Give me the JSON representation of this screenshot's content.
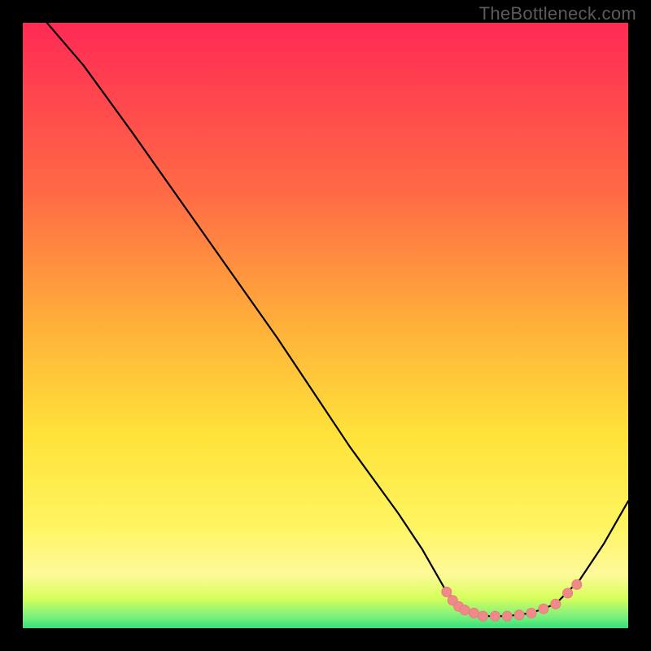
{
  "watermark": "TheBottleneck.com",
  "colors": {
    "frame": "#000000",
    "watermark": "#5b5b5b",
    "gradient_top": "#ff2a55",
    "gradient_mid_orange": "#ff8a3c",
    "gradient_yellow": "#ffe23a",
    "gradient_pale_yellow": "#fff99a",
    "gradient_lime": "#d7ff5b",
    "gradient_green": "#35e27a",
    "curve": "#000000",
    "marker_fill": "#f08a8a",
    "marker_stroke": "#e77d7d"
  },
  "chart_data": {
    "type": "line",
    "title": "",
    "xlabel": "",
    "ylabel": "",
    "x_range": [
      0,
      100
    ],
    "y_range": [
      0,
      100
    ],
    "curve": {
      "name": "bottleneck-curve",
      "points": [
        {
          "x": 4,
          "y": 100
        },
        {
          "x": 10,
          "y": 93
        },
        {
          "x": 18,
          "y": 82
        },
        {
          "x": 30,
          "y": 65
        },
        {
          "x": 42,
          "y": 48
        },
        {
          "x": 54,
          "y": 30
        },
        {
          "x": 62,
          "y": 19
        },
        {
          "x": 66,
          "y": 13
        },
        {
          "x": 70,
          "y": 6
        },
        {
          "x": 73,
          "y": 3
        },
        {
          "x": 76,
          "y": 2
        },
        {
          "x": 80,
          "y": 2
        },
        {
          "x": 84,
          "y": 2.5
        },
        {
          "x": 88,
          "y": 4
        },
        {
          "x": 92,
          "y": 8
        },
        {
          "x": 96,
          "y": 14
        },
        {
          "x": 100,
          "y": 21
        }
      ]
    },
    "markers": {
      "name": "highlighted-range",
      "points": [
        {
          "x": 70,
          "y": 6
        },
        {
          "x": 71,
          "y": 4.6
        },
        {
          "x": 72,
          "y": 3.6
        },
        {
          "x": 73,
          "y": 3
        },
        {
          "x": 74.5,
          "y": 2.5
        },
        {
          "x": 76,
          "y": 2
        },
        {
          "x": 78,
          "y": 2
        },
        {
          "x": 80,
          "y": 2
        },
        {
          "x": 82,
          "y": 2.2
        },
        {
          "x": 84,
          "y": 2.5
        },
        {
          "x": 86,
          "y": 3.2
        },
        {
          "x": 88,
          "y": 4
        },
        {
          "x": 90,
          "y": 5.8
        },
        {
          "x": 91.5,
          "y": 7.2
        }
      ]
    }
  }
}
